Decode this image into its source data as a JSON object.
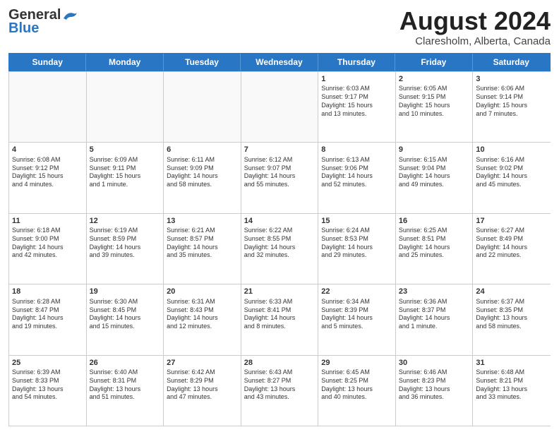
{
  "header": {
    "logo_line1": "General",
    "logo_line2": "Blue",
    "month": "August 2024",
    "location": "Claresholm, Alberta, Canada"
  },
  "weekdays": [
    "Sunday",
    "Monday",
    "Tuesday",
    "Wednesday",
    "Thursday",
    "Friday",
    "Saturday"
  ],
  "weeks": [
    [
      {
        "day": "",
        "info": "",
        "shaded": true
      },
      {
        "day": "",
        "info": "",
        "shaded": true
      },
      {
        "day": "",
        "info": "",
        "shaded": true
      },
      {
        "day": "",
        "info": "",
        "shaded": true
      },
      {
        "day": "1",
        "info": "Sunrise: 6:03 AM\nSunset: 9:17 PM\nDaylight: 15 hours\nand 13 minutes.",
        "shaded": false
      },
      {
        "day": "2",
        "info": "Sunrise: 6:05 AM\nSunset: 9:15 PM\nDaylight: 15 hours\nand 10 minutes.",
        "shaded": false
      },
      {
        "day": "3",
        "info": "Sunrise: 6:06 AM\nSunset: 9:14 PM\nDaylight: 15 hours\nand 7 minutes.",
        "shaded": false
      }
    ],
    [
      {
        "day": "4",
        "info": "Sunrise: 6:08 AM\nSunset: 9:12 PM\nDaylight: 15 hours\nand 4 minutes.",
        "shaded": false
      },
      {
        "day": "5",
        "info": "Sunrise: 6:09 AM\nSunset: 9:11 PM\nDaylight: 15 hours\nand 1 minute.",
        "shaded": false
      },
      {
        "day": "6",
        "info": "Sunrise: 6:11 AM\nSunset: 9:09 PM\nDaylight: 14 hours\nand 58 minutes.",
        "shaded": false
      },
      {
        "day": "7",
        "info": "Sunrise: 6:12 AM\nSunset: 9:07 PM\nDaylight: 14 hours\nand 55 minutes.",
        "shaded": false
      },
      {
        "day": "8",
        "info": "Sunrise: 6:13 AM\nSunset: 9:06 PM\nDaylight: 14 hours\nand 52 minutes.",
        "shaded": false
      },
      {
        "day": "9",
        "info": "Sunrise: 6:15 AM\nSunset: 9:04 PM\nDaylight: 14 hours\nand 49 minutes.",
        "shaded": false
      },
      {
        "day": "10",
        "info": "Sunrise: 6:16 AM\nSunset: 9:02 PM\nDaylight: 14 hours\nand 45 minutes.",
        "shaded": false
      }
    ],
    [
      {
        "day": "11",
        "info": "Sunrise: 6:18 AM\nSunset: 9:00 PM\nDaylight: 14 hours\nand 42 minutes.",
        "shaded": false
      },
      {
        "day": "12",
        "info": "Sunrise: 6:19 AM\nSunset: 8:59 PM\nDaylight: 14 hours\nand 39 minutes.",
        "shaded": false
      },
      {
        "day": "13",
        "info": "Sunrise: 6:21 AM\nSunset: 8:57 PM\nDaylight: 14 hours\nand 35 minutes.",
        "shaded": false
      },
      {
        "day": "14",
        "info": "Sunrise: 6:22 AM\nSunset: 8:55 PM\nDaylight: 14 hours\nand 32 minutes.",
        "shaded": false
      },
      {
        "day": "15",
        "info": "Sunrise: 6:24 AM\nSunset: 8:53 PM\nDaylight: 14 hours\nand 29 minutes.",
        "shaded": false
      },
      {
        "day": "16",
        "info": "Sunrise: 6:25 AM\nSunset: 8:51 PM\nDaylight: 14 hours\nand 25 minutes.",
        "shaded": false
      },
      {
        "day": "17",
        "info": "Sunrise: 6:27 AM\nSunset: 8:49 PM\nDaylight: 14 hours\nand 22 minutes.",
        "shaded": false
      }
    ],
    [
      {
        "day": "18",
        "info": "Sunrise: 6:28 AM\nSunset: 8:47 PM\nDaylight: 14 hours\nand 19 minutes.",
        "shaded": false
      },
      {
        "day": "19",
        "info": "Sunrise: 6:30 AM\nSunset: 8:45 PM\nDaylight: 14 hours\nand 15 minutes.",
        "shaded": false
      },
      {
        "day": "20",
        "info": "Sunrise: 6:31 AM\nSunset: 8:43 PM\nDaylight: 14 hours\nand 12 minutes.",
        "shaded": false
      },
      {
        "day": "21",
        "info": "Sunrise: 6:33 AM\nSunset: 8:41 PM\nDaylight: 14 hours\nand 8 minutes.",
        "shaded": false
      },
      {
        "day": "22",
        "info": "Sunrise: 6:34 AM\nSunset: 8:39 PM\nDaylight: 14 hours\nand 5 minutes.",
        "shaded": false
      },
      {
        "day": "23",
        "info": "Sunrise: 6:36 AM\nSunset: 8:37 PM\nDaylight: 14 hours\nand 1 minute.",
        "shaded": false
      },
      {
        "day": "24",
        "info": "Sunrise: 6:37 AM\nSunset: 8:35 PM\nDaylight: 13 hours\nand 58 minutes.",
        "shaded": false
      }
    ],
    [
      {
        "day": "25",
        "info": "Sunrise: 6:39 AM\nSunset: 8:33 PM\nDaylight: 13 hours\nand 54 minutes.",
        "shaded": false
      },
      {
        "day": "26",
        "info": "Sunrise: 6:40 AM\nSunset: 8:31 PM\nDaylight: 13 hours\nand 51 minutes.",
        "shaded": false
      },
      {
        "day": "27",
        "info": "Sunrise: 6:42 AM\nSunset: 8:29 PM\nDaylight: 13 hours\nand 47 minutes.",
        "shaded": false
      },
      {
        "day": "28",
        "info": "Sunrise: 6:43 AM\nSunset: 8:27 PM\nDaylight: 13 hours\nand 43 minutes.",
        "shaded": false
      },
      {
        "day": "29",
        "info": "Sunrise: 6:45 AM\nSunset: 8:25 PM\nDaylight: 13 hours\nand 40 minutes.",
        "shaded": false
      },
      {
        "day": "30",
        "info": "Sunrise: 6:46 AM\nSunset: 8:23 PM\nDaylight: 13 hours\nand 36 minutes.",
        "shaded": false
      },
      {
        "day": "31",
        "info": "Sunrise: 6:48 AM\nSunset: 8:21 PM\nDaylight: 13 hours\nand 33 minutes.",
        "shaded": false
      }
    ]
  ]
}
